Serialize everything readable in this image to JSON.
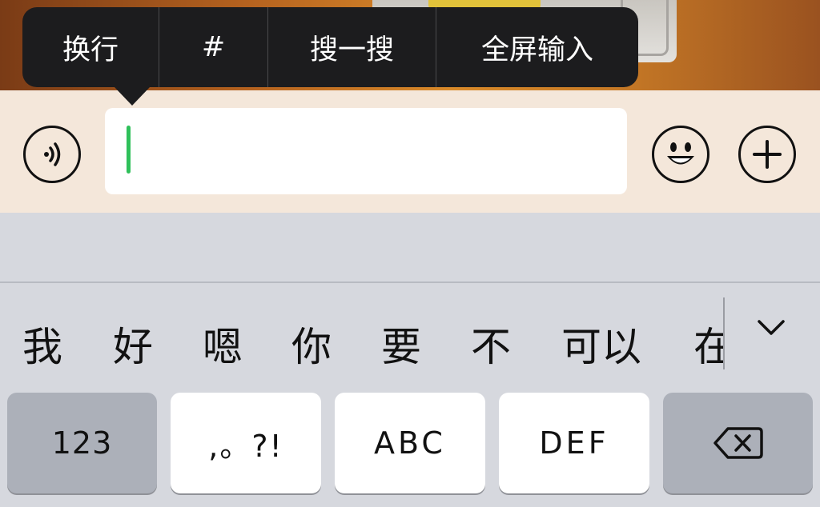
{
  "popup_menu": {
    "items": [
      "换行",
      "#",
      "搜一搜",
      "全屏输入"
    ]
  },
  "input": {
    "value": ""
  },
  "candidates": {
    "words": [
      "我",
      "好",
      "嗯",
      "你",
      "要",
      "不",
      "可以",
      "在"
    ]
  },
  "keyboard": {
    "keys": [
      "123",
      ",。?!",
      "ABC",
      "DEF"
    ]
  },
  "colors": {
    "caret": "#2fc05a",
    "popup_bg": "#1c1c1e",
    "input_bar_bg": "#f4e7da",
    "keyboard_bg": "#d6d8de"
  },
  "icons": {
    "voice": "voice-wave-icon",
    "emoji": "smiley-face-icon",
    "plus": "plus-circle-icon",
    "expand": "chevron-down-icon",
    "delete": "backspace-icon"
  }
}
